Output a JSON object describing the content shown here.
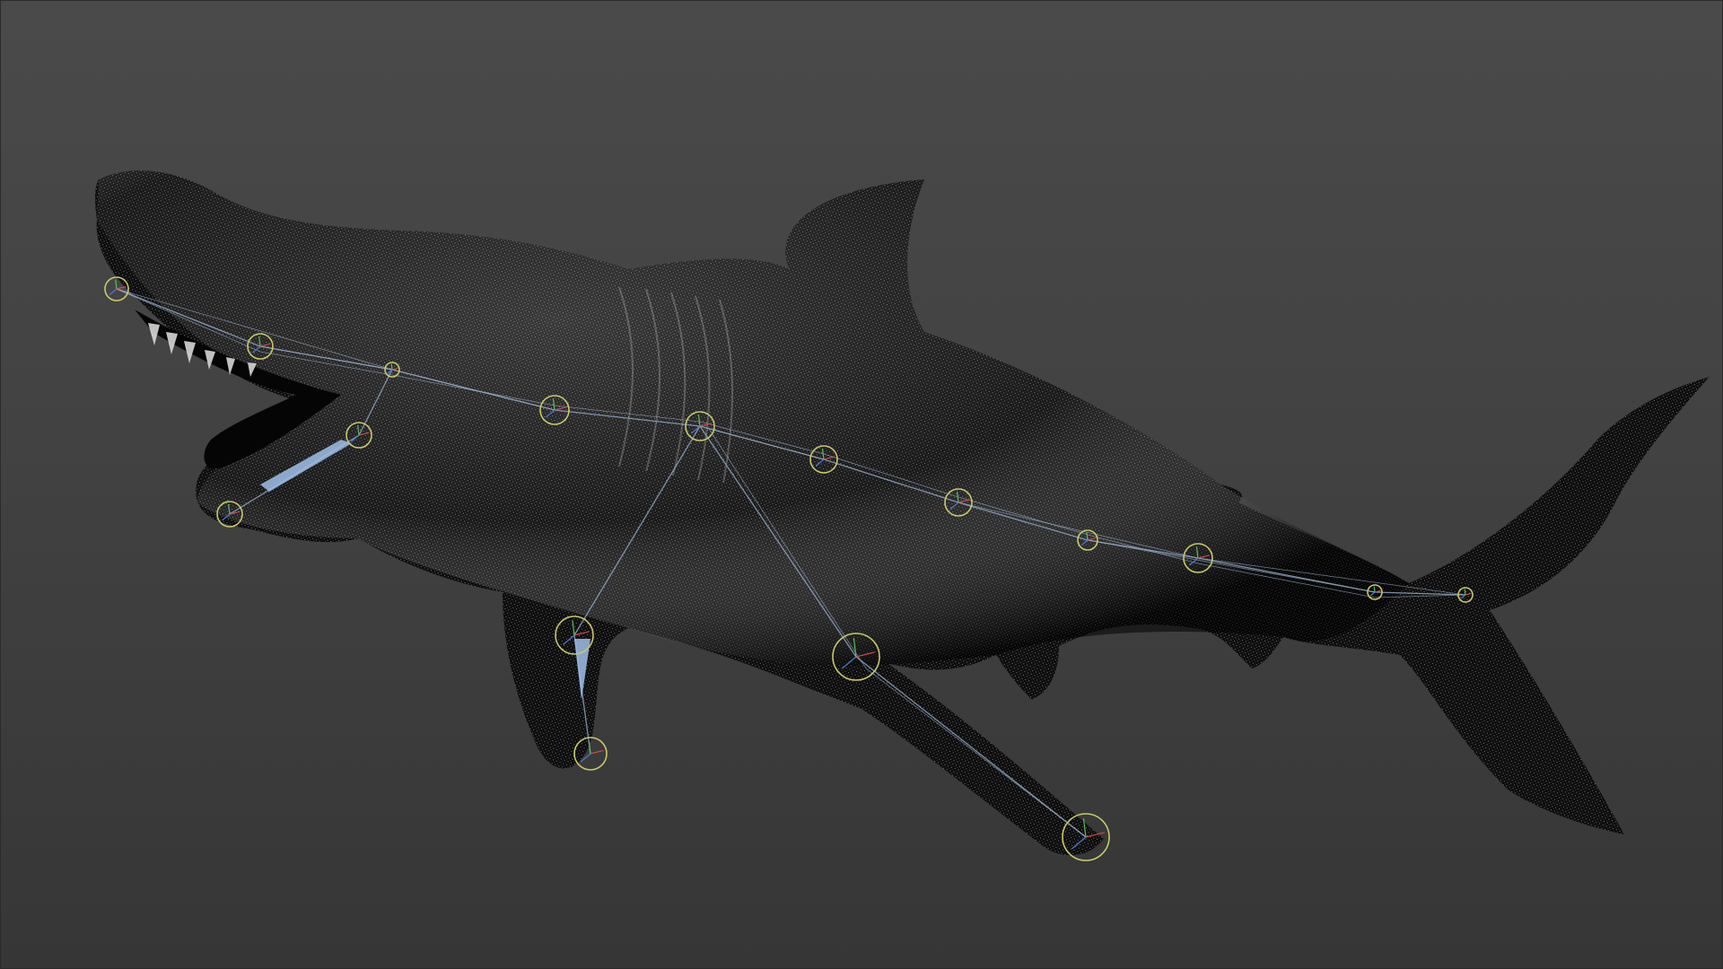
{
  "viewport": {
    "background_top": "#4a4a4a",
    "background_bottom": "#363636",
    "mesh_color": "#0a0a0a",
    "wire_color": "#bdbdbd",
    "bone_color": "#8fa6c4",
    "joint_color": "#c9c96a"
  },
  "model": {
    "shading": "wireframe-on-shaded",
    "rig": "skeleton-joints"
  },
  "icons": {
    "joint": "joint-ring-icon"
  }
}
